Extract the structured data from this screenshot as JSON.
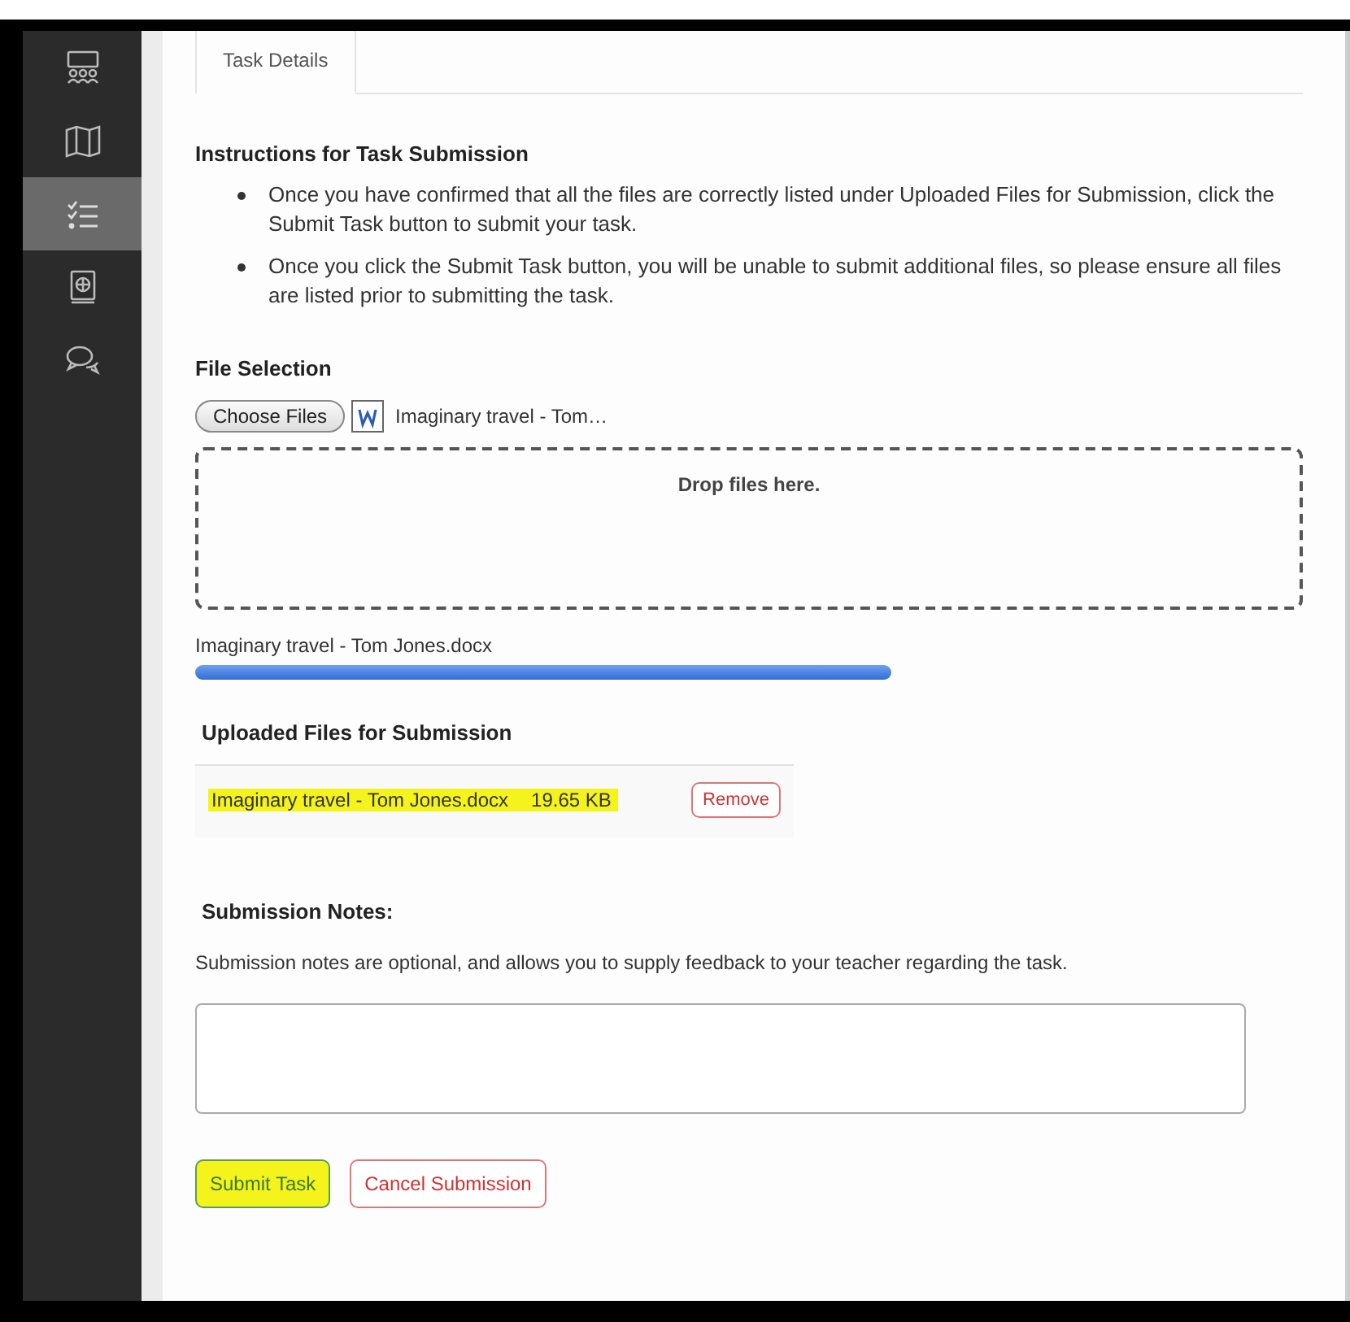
{
  "sidebar": {
    "items": [
      {
        "kind": "group",
        "selected": false
      },
      {
        "kind": "map",
        "selected": false
      },
      {
        "kind": "checklist",
        "selected": true
      },
      {
        "kind": "book",
        "selected": false
      },
      {
        "kind": "chat",
        "selected": false
      }
    ]
  },
  "tabs": [
    {
      "label": "Task Details",
      "selected": true
    }
  ],
  "instructions": {
    "title": "Instructions for Task Submission",
    "items": [
      "Once you have confirmed that all the files are correctly listed under Uploaded Files for Submission, click the Submit Task button to submit your task.",
      "Once you click the Submit Task button, you will be unable to submit additional files, so please ensure all files are listed prior to submitting the task."
    ]
  },
  "file_selection": {
    "title": "File Selection",
    "button": "Choose Files",
    "chosen": "Imaginary travel - Tom…",
    "drop_zone": "Drop files here.",
    "upload": {
      "name": "Imaginary travel - Tom Jones.docx"
    }
  },
  "uploaded": {
    "title": "Uploaded Files for Submission",
    "files": [
      {
        "name": "Imaginary travel - Tom Jones.docx",
        "size": "19.65 KB",
        "button": "Remove",
        "highlighted": true
      }
    ]
  },
  "notes": {
    "title": "Submission Notes:",
    "hint": "Submission notes are optional, and allows you to supply feedback to your teacher regarding the task."
  },
  "buttons": [
    {
      "label": "Submit Task",
      "kind": "submit",
      "highlighted": true
    },
    {
      "label": "Cancel Submission",
      "kind": "cancel",
      "highlighted": false
    }
  ]
}
